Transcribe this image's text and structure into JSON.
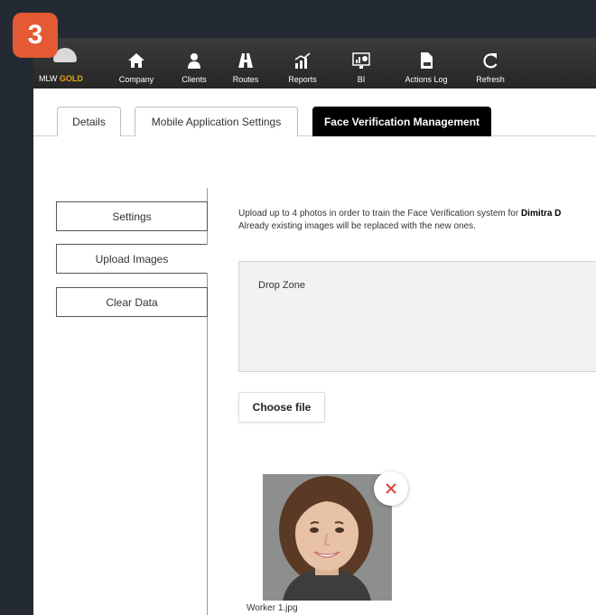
{
  "step_badge": "3",
  "brand": {
    "prefix": "MLW",
    "suffix": "GOLD"
  },
  "nav": [
    {
      "label": "Company",
      "icon": "home-icon"
    },
    {
      "label": "Clients",
      "icon": "person-icon"
    },
    {
      "label": "Routes",
      "icon": "road-icon"
    },
    {
      "label": "Reports",
      "icon": "bar-chart-icon"
    },
    {
      "label": "BI",
      "icon": "dashboard-icon"
    },
    {
      "label": "Actions Log",
      "icon": "log-file-icon"
    },
    {
      "label": "Refresh",
      "icon": "refresh-icon"
    }
  ],
  "tabs": [
    {
      "label": "Details",
      "active": false
    },
    {
      "label": "Mobile Application Settings",
      "active": false
    },
    {
      "label": "Face Verification Management",
      "active": true
    }
  ],
  "sidebar": [
    {
      "label": "Settings",
      "active": false
    },
    {
      "label": "Upload Images",
      "active": true
    },
    {
      "label": "Clear Data",
      "active": false
    }
  ],
  "upload": {
    "intro_prefix": "Upload up to 4 photos in order to train the Face Verification system for ",
    "worker_name": "Dimitra D",
    "intro_line2": "Already existing images will be replaced with the new ones.",
    "dropzone_label": "Drop Zone",
    "choose_file_label": "Choose file"
  },
  "images": [
    {
      "filename": "Worker 1.jpg"
    }
  ],
  "colors": {
    "badge": "#e35a34",
    "gold": "#e8a317",
    "remove": "#e0403c"
  }
}
